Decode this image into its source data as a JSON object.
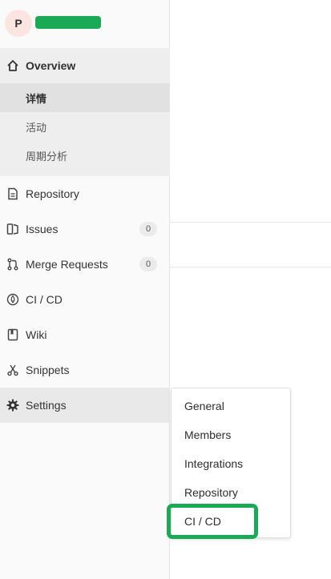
{
  "project": {
    "avatar_letter": "P"
  },
  "sidebar": {
    "overview": {
      "label": "Overview",
      "subitems": [
        "详情",
        "活动",
        "周期分析"
      ]
    },
    "items": [
      {
        "label": "Repository"
      },
      {
        "label": "Issues",
        "badge": "0"
      },
      {
        "label": "Merge Requests",
        "badge": "0"
      },
      {
        "label": "CI / CD"
      },
      {
        "label": "Wiki"
      },
      {
        "label": "Snippets"
      },
      {
        "label": "Settings"
      }
    ]
  },
  "settings_flyout": {
    "items": [
      "General",
      "Members",
      "Integrations",
      "Repository",
      "CI / CD"
    ]
  },
  "colors": {
    "highlight": "#1aaa55",
    "redaction": "#1aaa55"
  }
}
